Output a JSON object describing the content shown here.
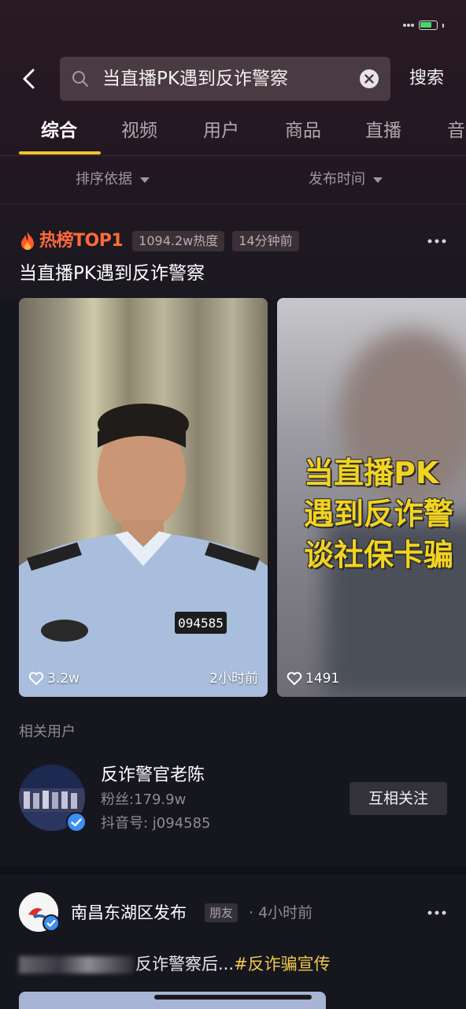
{
  "search": {
    "query": "当直播PK遇到反诈警察",
    "submit_label": "搜索"
  },
  "tabs": [
    {
      "label": "综合",
      "active": true
    },
    {
      "label": "视频",
      "active": false
    },
    {
      "label": "用户",
      "active": false
    },
    {
      "label": "商品",
      "active": false
    },
    {
      "label": "直播",
      "active": false
    },
    {
      "label": "音",
      "active": false
    }
  ],
  "filters": {
    "sort": "排序依据",
    "publish_time": "发布时间"
  },
  "hot": {
    "badge": "热榜TOP1",
    "heat": "1094.2w热度",
    "time": "14分钟前",
    "title": "当直播PK遇到反诈警察"
  },
  "videos": [
    {
      "likes": "3.2w",
      "time": "2小时前",
      "badge_number": "094585"
    },
    {
      "likes": "1491",
      "overlay_lines": [
        "当直播PK",
        "遇到反诈警",
        "谈社保卡骗"
      ]
    }
  ],
  "related_users": {
    "label": "相关用户",
    "user": {
      "name": "反诈警官老陈",
      "fans": "粉丝:179.9w",
      "douyin_id": "抖音号:  j094585",
      "follow_label": "互相关注"
    }
  },
  "post": {
    "author": "南昌东湖区发布",
    "friend_tag": "朋友",
    "time": "· 4小时前",
    "text": "反诈警察后...",
    "hashtag": "#反诈骗宣传"
  },
  "colors": {
    "accent": "#f2c22d",
    "hot_label": "#ff6a3a",
    "verified": "#3d8ef0",
    "hashtag": "#f2c94c",
    "background": "#16161f"
  },
  "icons": [
    "back-arrow-icon",
    "search-icon",
    "clear-icon",
    "flame-icon",
    "more-icon",
    "heart-icon",
    "verified-icon"
  ]
}
